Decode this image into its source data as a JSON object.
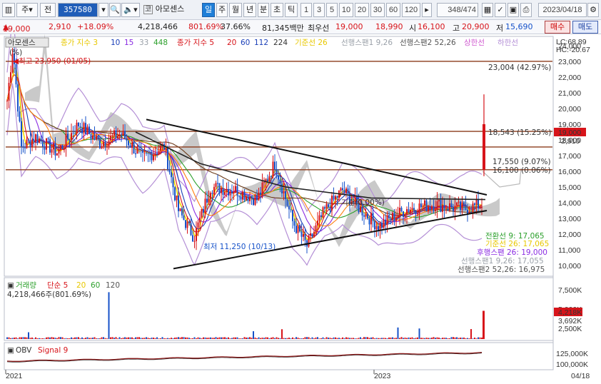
{
  "toolbar": {
    "view_button": "주",
    "prev_button": "전",
    "code": "357580",
    "name": "아모센스",
    "periods": [
      "일",
      "주",
      "월",
      "년",
      "분",
      "초",
      "틱"
    ],
    "active_period": "일",
    "intervals": [
      "1",
      "3",
      "5",
      "10",
      "20",
      "30",
      "60",
      "120"
    ],
    "count": "348/474",
    "date": "2023/04/18",
    "icons": [
      "list-icon",
      "search-icon",
      "speaker-icon",
      "pin-icon",
      "refresh-icon",
      "save-icon",
      "print-icon",
      "calendar-icon",
      "settings-icon"
    ]
  },
  "quote": {
    "price": "19,000",
    "change": "2,910",
    "change_pct": "+18.09%",
    "volume": "4,218,466",
    "volume_ratio": "801.69%",
    "turnover": "37.66%",
    "amount": "81,345백만",
    "priority_label": "최우선",
    "ask": "19,000",
    "bid": "18,990",
    "open_label": "시",
    "open": "16,100",
    "high_label": "고",
    "high": "20,900",
    "low_label": "저",
    "low": "15,690",
    "buy_label": "매수",
    "sell_label": "매도"
  },
  "legend": {
    "stock_name": "아모센스",
    "ma_label": "종가 지수 3",
    "ma_periods": [
      "10",
      "15",
      "33",
      "448"
    ],
    "ma2_label": "종가 지수 5",
    "ma2_periods": [
      "20",
      "60",
      "112",
      "224"
    ],
    "base_line": "기준선 26",
    "lead_span1": "선행스팬1 9,26",
    "lead_span2": "선행스팬2 52,26",
    "upper_band": "상한선",
    "lower_band": "하한선",
    "lc": "LC:68.89",
    "hc": "HC:-20.67",
    "pct_label": "(%)"
  },
  "colors": {
    "up": "#d7141a",
    "down": "#1652c9",
    "ma3": "#f2d800",
    "ma10": "#1a3fb8",
    "ma15": "#8a2be2",
    "ma33": "#2ca02c",
    "ma448": "#6b3b1b",
    "ichimoku": "#9c9c9c",
    "bollinger": "#b48fd6",
    "hline": "#8b3a1a",
    "trend": "#111111"
  },
  "annotations": {
    "max": "최고 23,950 (01/05)",
    "min": "최저 11,250 (10/13)",
    "h1": "23,004 (42.97%)",
    "h2": "18,543 (15.25%)",
    "h3": "17,550 (9.07%)",
    "h4": "16,100 (0.06%)",
    "mid": "기준(0.00%)",
    "conv": "전환선 9: 17,065",
    "base": "기준선 26: 17,065",
    "lag": "후행스팬 26: 19,000",
    "span1": "선행스팬1 9,26: 17,055",
    "span2": "선행스팬2 52,26: 16,975"
  },
  "price_axis": {
    "ticks": [
      "24,000",
      "23,000",
      "22,000",
      "21,000",
      "20,000",
      "19,000",
      "18,000",
      "17,000",
      "16,000",
      "15,000",
      "14,000",
      "13,000",
      "12,000",
      "11,000",
      "10,000"
    ],
    "current_price": "19,000",
    "current_change": "2,910"
  },
  "volume_panel": {
    "label": "거래량",
    "ma_label": "단순 5",
    "ma_periods": [
      "20",
      "60",
      "120"
    ],
    "value": "4,218,466주(801.69%)",
    "ticks": [
      "7,500K",
      "5,000K",
      "2,500K"
    ],
    "current": "4,218K",
    "ma_value": "3,692K"
  },
  "obv_panel": {
    "label": "OBV",
    "signal": "Signal 9",
    "ticks": [
      "125,000K",
      "100,000K"
    ]
  },
  "date_axis": {
    "labels": [
      "2021",
      "2023"
    ],
    "end": "04/18"
  },
  "chart_data": {
    "type": "candlestick",
    "title": "",
    "price_range": [
      9500,
      24500
    ],
    "hlines": [
      23004,
      18543,
      17550,
      16100
    ],
    "max": {
      "value": 23950,
      "date": "01/05"
    },
    "min": {
      "value": 11250,
      "date": "10/13"
    },
    "last": {
      "close": 19000,
      "open": 16100,
      "high": 20900,
      "low": 15690
    }
  }
}
